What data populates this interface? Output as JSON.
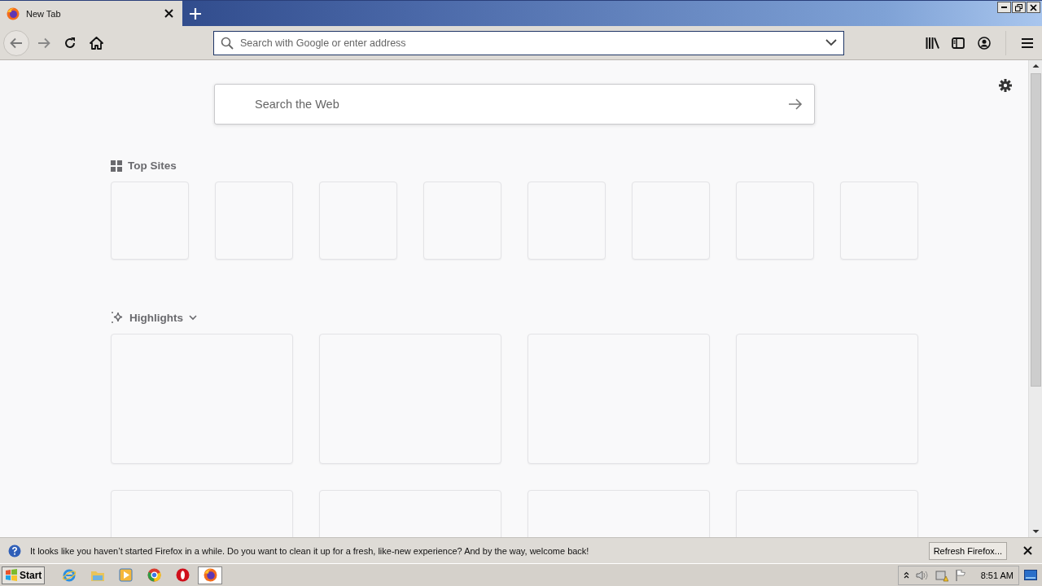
{
  "tabs": [
    {
      "title": "New Tab",
      "selected": true
    }
  ],
  "address_bar": {
    "placeholder": "Search with Google or enter address"
  },
  "search": {
    "placeholder": "Search the Web"
  },
  "top_sites": {
    "title": "Top Sites",
    "tiles": [
      {
        "kind": "empty"
      },
      {
        "kind": "empty"
      },
      {
        "kind": "empty"
      },
      {
        "kind": "empty"
      },
      {
        "kind": "empty"
      },
      {
        "kind": "empty"
      },
      {
        "kind": "empty"
      },
      {
        "kind": "empty"
      }
    ]
  },
  "highlights": {
    "title": "Highlights",
    "expanded": true,
    "cards": [
      {
        "kind": "empty"
      },
      {
        "kind": "empty"
      },
      {
        "kind": "empty"
      },
      {
        "kind": "empty"
      },
      {
        "kind": "empty"
      },
      {
        "kind": "empty"
      },
      {
        "kind": "empty"
      },
      {
        "kind": "empty"
      }
    ]
  },
  "notification": {
    "message": "It looks like you haven’t started Firefox in a while. Do you want to clean it up for a fresh, like-new experience? And by the way, welcome back!",
    "button": "Refresh Firefox..."
  },
  "taskbar": {
    "start": "Start",
    "apps": [
      {
        "kind": "ie",
        "selected": false
      },
      {
        "kind": "folder",
        "selected": false
      },
      {
        "kind": "media",
        "selected": false
      },
      {
        "kind": "chrome",
        "selected": false
      },
      {
        "kind": "opera",
        "selected": false
      },
      {
        "kind": "firefox",
        "selected": true
      }
    ],
    "clock": "8:51 AM"
  }
}
